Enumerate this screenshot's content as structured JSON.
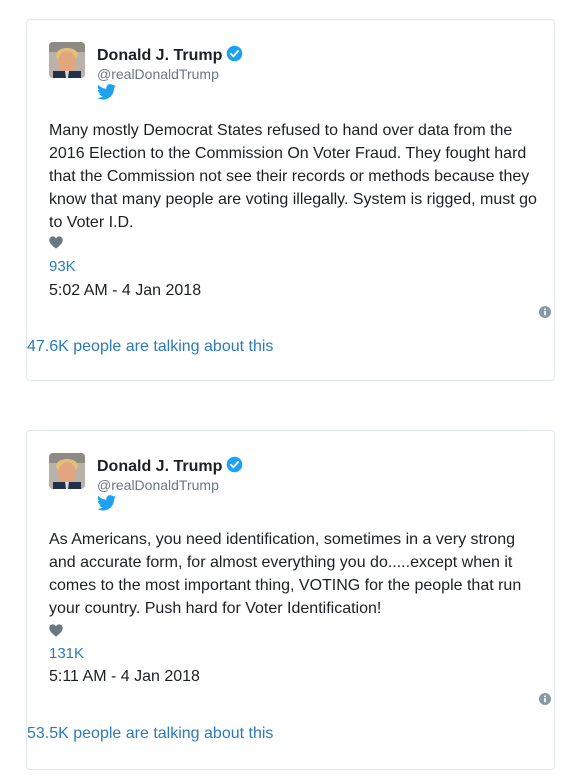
{
  "tweets": [
    {
      "author": {
        "display_name": "Donald J. Trump",
        "screen_name": "@realDonaldTrump",
        "verified": true
      },
      "text": "Many mostly Democrat States refused to hand over data from the 2016 Election to the Commission On Voter Fraud. They fought hard that the Commission not see their records or methods because they know that many people are voting illegally. System is rigged, must go to Voter I.D.",
      "like_count": "93K",
      "timestamp": "5:02 AM - 4 Jan 2018",
      "talking_text": "47.6K people are talking about this"
    },
    {
      "author": {
        "display_name": "Donald J. Trump",
        "screen_name": "@realDonaldTrump",
        "verified": true
      },
      "text": "As Americans, you need identification, sometimes in a very strong and accurate form, for almost everything you do.....except when it comes to the most important thing, VOTING for the people that run your country. Push hard for Voter Identification!",
      "like_count": "131K",
      "timestamp": "5:11 AM - 4 Jan 2018",
      "talking_text": "53.5K people are talking about this"
    }
  ],
  "colors": {
    "link_blue": "#2b7bb9",
    "verified_blue": "#1da1f2",
    "secondary_text": "#697882",
    "heart_gray": "#697882",
    "card_border": "#e1e8ed"
  },
  "icons": [
    "verified-badge-icon",
    "twitter-bird-icon",
    "heart-icon",
    "info-icon"
  ]
}
